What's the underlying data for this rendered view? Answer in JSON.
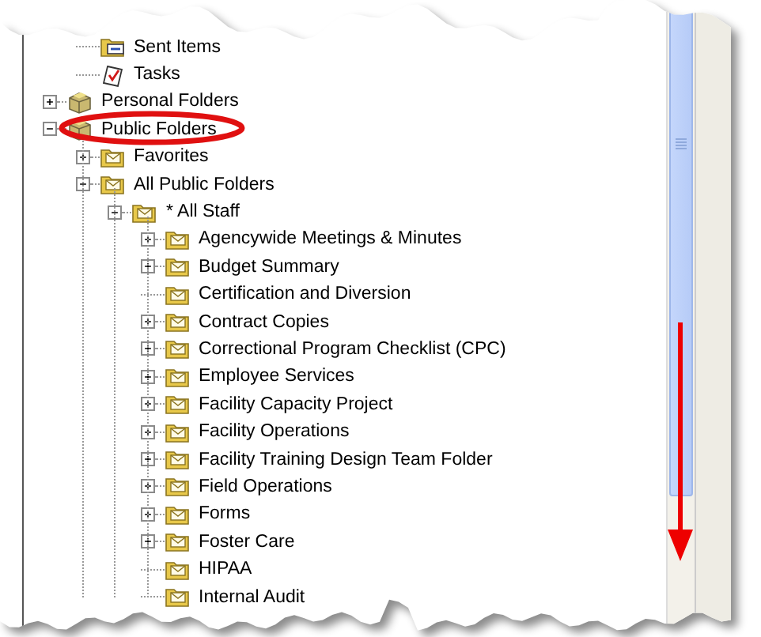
{
  "inbox_subfolders": [
    {
      "label": "Sent Items",
      "kind": "sent"
    },
    {
      "label": "Tasks",
      "kind": "tasks"
    }
  ],
  "tree": [
    {
      "label": "Personal Folders",
      "kind": "store",
      "expanded": false
    },
    {
      "label": "Public Folders",
      "kind": "store",
      "expanded": true,
      "children": [
        {
          "label": "Favorites",
          "kind": "folder",
          "expanded": false
        },
        {
          "label": "All Public Folders",
          "kind": "folder",
          "expanded": true,
          "children": [
            {
              "label": "* All Staff",
              "kind": "folder",
              "expanded": true,
              "children": [
                {
                  "label": "Agencywide Meetings & Minutes",
                  "kind": "folder",
                  "expanded": false
                },
                {
                  "label": "Budget Summary",
                  "kind": "folder",
                  "expanded": false
                },
                {
                  "label": "Certification and Diversion",
                  "kind": "folder"
                },
                {
                  "label": "Contract Copies",
                  "kind": "folder",
                  "expanded": false
                },
                {
                  "label": "Correctional Program Checklist (CPC)",
                  "kind": "folder",
                  "expanded": false
                },
                {
                  "label": "Employee Services",
                  "kind": "folder",
                  "expanded": false
                },
                {
                  "label": "Facility Capacity Project",
                  "kind": "folder",
                  "expanded": false
                },
                {
                  "label": "Facility Operations",
                  "kind": "folder",
                  "expanded": false
                },
                {
                  "label": "Facility Training Design Team Folder",
                  "kind": "folder",
                  "expanded": false
                },
                {
                  "label": "Field Operations",
                  "kind": "folder",
                  "expanded": false
                },
                {
                  "label": "Forms",
                  "kind": "folder",
                  "expanded": false
                },
                {
                  "label": "Foster Care",
                  "kind": "folder",
                  "expanded": false
                },
                {
                  "label": "HIPAA",
                  "kind": "folder"
                },
                {
                  "label": "Internal Audit",
                  "kind": "folder"
                }
              ]
            }
          ]
        }
      ]
    }
  ]
}
